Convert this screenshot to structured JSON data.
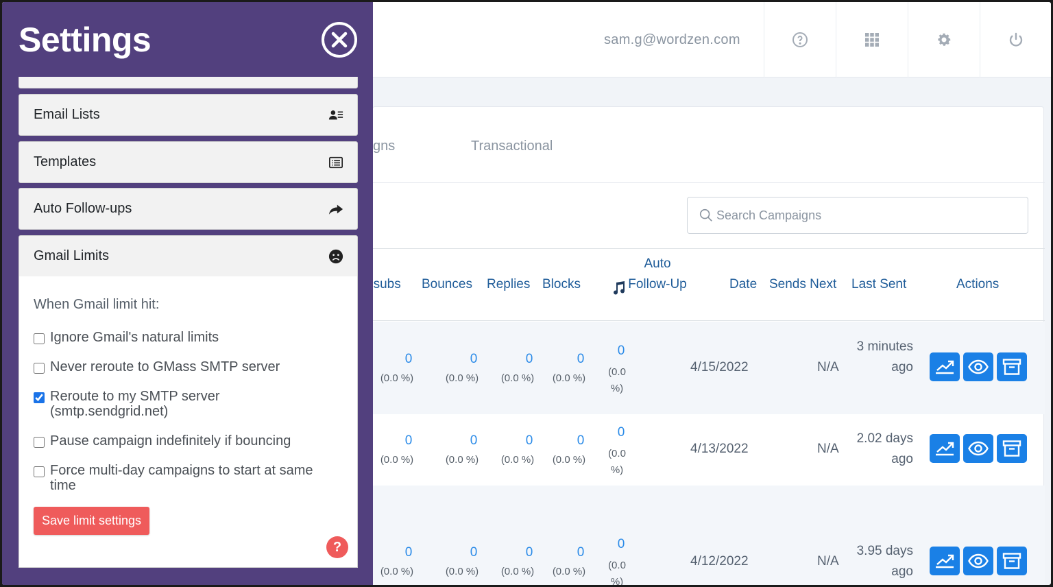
{
  "topbar": {
    "user_email": "sam.g@wordzen.com",
    "icons": [
      "help-circle-icon",
      "apps-grid-icon",
      "gear-icon",
      "power-icon"
    ]
  },
  "tabs": [
    "gns",
    "Transactional"
  ],
  "search": {
    "placeholder": "Search Campaigns"
  },
  "table": {
    "headers": {
      "unsubs": "nsubs",
      "bounces": "Bounces",
      "replies": "Replies",
      "blocks": "Blocks",
      "auto_follow_up": "Auto Follow-Up",
      "date": "Date",
      "sends_next": "Sends Next",
      "last_sent": "Last Sent",
      "actions": "Actions"
    },
    "rows": [
      {
        "unsubs": "0",
        "unsubs_pct": "(0.0 %)",
        "bounces": "0",
        "bounces_pct": "(0.0 %)",
        "replies": "0",
        "replies_pct": "(0.0 %)",
        "blocks": "0",
        "blocks_pct": "(0.0 %)",
        "auto": "0",
        "auto_pct": "(0.0 %)",
        "date": "4/15/2022",
        "sends_next": "N/A",
        "last_sent": "3 minutes ago"
      },
      {
        "unsubs": "0",
        "unsubs_pct": "(0.0 %)",
        "bounces": "0",
        "bounces_pct": "(0.0 %)",
        "replies": "0",
        "replies_pct": "(0.0 %)",
        "blocks": "0",
        "blocks_pct": "(0.0 %)",
        "auto": "0",
        "auto_pct": "(0.0 %)",
        "date": "4/13/2022",
        "sends_next": "N/A",
        "last_sent": "2.02 days ago"
      },
      {
        "unsubs": "0",
        "unsubs_pct": "(0.0 %)",
        "bounces": "0",
        "bounces_pct": "(0.0 %)",
        "replies": "0",
        "replies_pct": "(0.0 %)",
        "blocks": "0",
        "blocks_pct": "(0.0 %)",
        "auto": "0",
        "auto_pct": "(0.0 %)",
        "date": "4/12/2022",
        "sends_next": "N/A",
        "last_sent": "3.95 days ago"
      }
    ]
  },
  "settings": {
    "title": "Settings",
    "menu": [
      {
        "label": "Email Lists",
        "icon": "contact-list-icon"
      },
      {
        "label": "Templates",
        "icon": "template-list-icon"
      },
      {
        "label": "Auto Follow-ups",
        "icon": "share-arrow-icon"
      },
      {
        "label": "Gmail Limits",
        "icon": "sad-face-icon"
      }
    ],
    "gmail_limits": {
      "heading": "When Gmail limit hit:",
      "options": [
        {
          "label": "Ignore Gmail's natural limits",
          "checked": false
        },
        {
          "label": "Never reroute to GMass SMTP server",
          "checked": false
        },
        {
          "label": "Reroute to my SMTP server",
          "sub": "(smtp.sendgrid.net)",
          "checked": true
        },
        {
          "label": "Pause campaign indefinitely if bouncing",
          "checked": false
        },
        {
          "label": "Force multi-day campaigns to start at same time",
          "checked": false
        }
      ],
      "save_label": "Save limit settings",
      "help_label": "?"
    }
  },
  "colors": {
    "panel_bg": "#52407e",
    "accent_blue": "#1a80e6",
    "save_red": "#ef5b5b"
  }
}
